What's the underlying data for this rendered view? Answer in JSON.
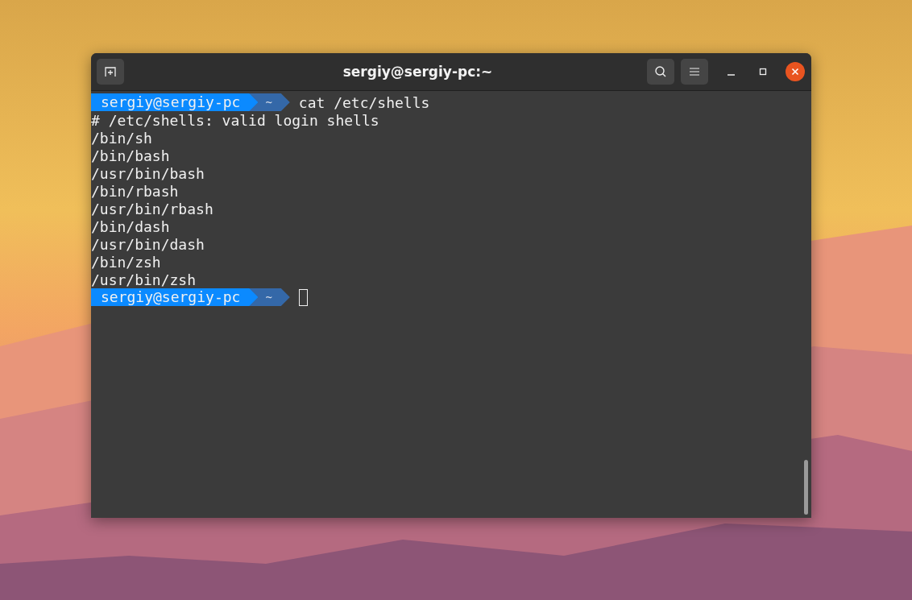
{
  "window": {
    "title": "sergiy@sergiy-pc:~"
  },
  "terminal": {
    "lines": [
      {
        "kind": "prompt",
        "user": "sergiy@sergiy-pc",
        "dir": "~",
        "command": "cat /etc/shells"
      },
      {
        "kind": "output",
        "text": "# /etc/shells: valid login shells"
      },
      {
        "kind": "output",
        "text": "/bin/sh"
      },
      {
        "kind": "output",
        "text": "/bin/bash"
      },
      {
        "kind": "output",
        "text": "/usr/bin/bash"
      },
      {
        "kind": "output",
        "text": "/bin/rbash"
      },
      {
        "kind": "output",
        "text": "/usr/bin/rbash"
      },
      {
        "kind": "output",
        "text": "/bin/dash"
      },
      {
        "kind": "output",
        "text": "/usr/bin/dash"
      },
      {
        "kind": "output",
        "text": "/bin/zsh"
      },
      {
        "kind": "output",
        "text": "/usr/bin/zsh"
      },
      {
        "kind": "prompt",
        "user": "sergiy@sergiy-pc",
        "dir": "~",
        "cursor": true
      }
    ]
  }
}
